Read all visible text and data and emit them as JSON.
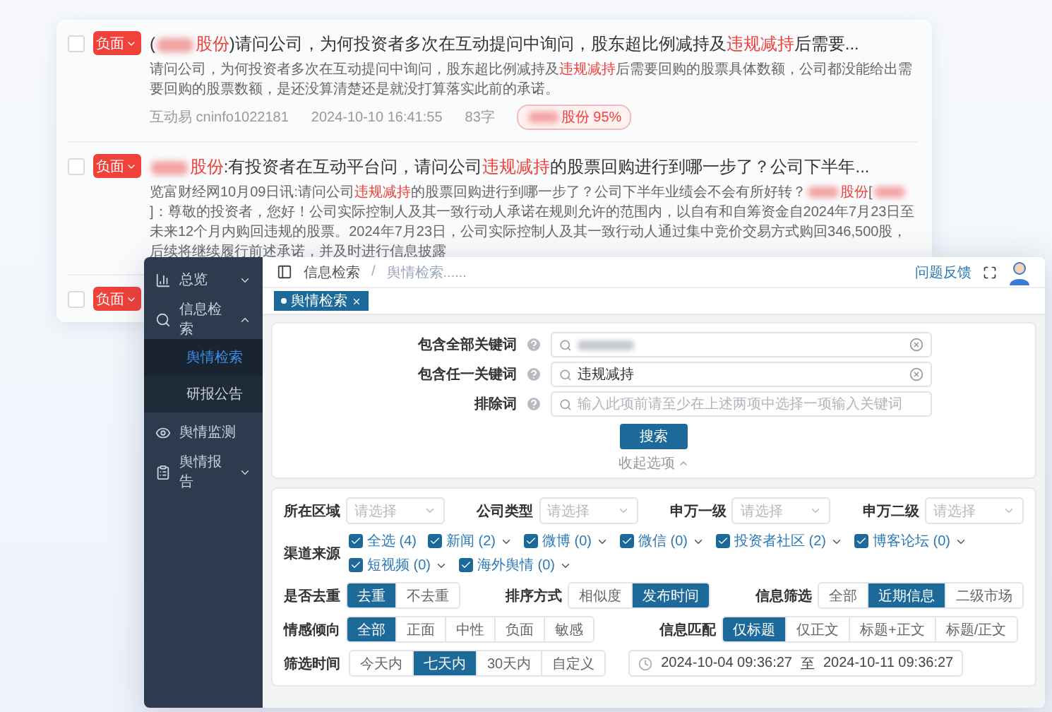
{
  "results": [
    {
      "sentiment": "负面",
      "checked": false,
      "title": [
        {
          "text": "("
        },
        {
          "kind": "blur"
        },
        {
          "text": "股份",
          "highlight": true
        },
        {
          "text": ")请问公司，为何投资者多次在互动提问中询问，股东超比例减持及"
        },
        {
          "text": "违规减持",
          "highlight": true
        },
        {
          "text": "后需要..."
        }
      ],
      "summary": [
        {
          "text": "请问公司，为何投资者多次在互动提问中询问，股东超比例减持及"
        },
        {
          "text": "违规减持",
          "highlight": true
        },
        {
          "text": "后需要回购的股票具体数额，公司都没能给出需要回购的股票数额，是还没算清楚还是就没打算落实此前的承诺。"
        }
      ],
      "meta": {
        "source": "互动易 cninfo1022181",
        "time": "2024-10-10 16:41:55",
        "length": "83字",
        "match": [
          {
            "kind": "blur"
          },
          {
            "text": "股份 95%"
          }
        ]
      }
    },
    {
      "sentiment": "负面",
      "checked": false,
      "title": [
        {
          "kind": "blur"
        },
        {
          "text": "股份",
          "highlight": true
        },
        {
          "text": ":有投资者在互动平台问，请问公司"
        },
        {
          "text": "违规减持",
          "highlight": true
        },
        {
          "text": "的股票回购进行到哪一步了？公司下半年..."
        }
      ],
      "summary": [
        {
          "text": "览富财经网10月09日讯:请问公司"
        },
        {
          "text": "违规减持",
          "highlight": true
        },
        {
          "text": "的股票回购进行到哪一步了？公司下半年业绩会不会有所好转？"
        },
        {
          "kind": "blur"
        },
        {
          "text": "股份",
          "highlight": true
        },
        {
          "text": "["
        },
        {
          "kind": "blur"
        },
        {
          "text": "]：尊敬的投资者，您好！公司实际控制人及其一致行动人承诺在规则允许的范围内，以自有和自筹资金自2024年7月23日至未来12个月内购回违规的股票。2024年7月23日，公司实际控制人及其一致行动人通过集中竞价交易方式购回346,500股，后续将继续履行前述承诺，并及时进行信息披露"
        }
      ]
    },
    {
      "sentiment": "负面",
      "checked": false
    }
  ],
  "app": {
    "sidebar": [
      {
        "label": "总览",
        "selected": false,
        "expanded": false
      },
      {
        "label": "信息检索",
        "selected": false,
        "expanded": true,
        "children": [
          {
            "label": "舆情检索",
            "selected": true
          },
          {
            "label": "研报公告",
            "selected": false
          }
        ]
      },
      {
        "label": "舆情监测",
        "selected": false
      },
      {
        "label": "舆情报告",
        "selected": false,
        "expanded": false
      }
    ],
    "breadcrumb": {
      "separator": "/",
      "items": [
        "信息检索",
        "舆情检索......"
      ]
    },
    "feedback": "问题反馈",
    "open_tabs": [
      {
        "label": "舆情检索",
        "selected": true
      }
    ],
    "keywords": [
      {
        "label": "包含全部关键词",
        "value_hidden": true
      },
      {
        "label": "包含任一关键词",
        "value": "违规减持"
      },
      {
        "label": "排除词",
        "placeholder": "输入此项前请至少在上述两项中选择一项输入关键词"
      }
    ],
    "search_button": "搜索",
    "collapse_link": "收起选项",
    "selects": [
      {
        "label": "所在区域",
        "placeholder": "请选择"
      },
      {
        "label": "公司类型",
        "placeholder": "请选择"
      },
      {
        "label": "申万一级",
        "placeholder": "请选择"
      },
      {
        "label": "申万二级",
        "placeholder": "请选择"
      }
    ],
    "channels": {
      "label": "渠道来源",
      "items": [
        {
          "label": "全选 (4)",
          "checked": true,
          "kind": "all"
        },
        {
          "label": "新闻 (2)",
          "checked": true,
          "kind": "menu"
        },
        {
          "label": "微博 (0)",
          "checked": true,
          "kind": "menu"
        },
        {
          "label": "微信 (0)",
          "checked": true,
          "kind": "menu"
        },
        {
          "label": "投资者社区 (2)",
          "checked": true,
          "kind": "menu"
        },
        {
          "label": "博客论坛 (0)",
          "checked": true,
          "kind": "menu"
        },
        {
          "label": "短视频 (0)",
          "checked": true,
          "kind": "menu"
        },
        {
          "label": "海外舆情 (0)",
          "checked": true,
          "kind": "menu"
        }
      ]
    },
    "option_groups": [
      [
        {
          "label": "是否去重",
          "options": [
            {
              "label": "去重",
              "selected": true
            },
            {
              "label": "不去重",
              "selected": false
            }
          ]
        },
        {
          "label": "排序方式",
          "options": [
            {
              "label": "相似度",
              "selected": false
            },
            {
              "label": "发布时间",
              "selected": true
            }
          ]
        },
        {
          "label": "信息筛选",
          "options": [
            {
              "label": "全部",
              "selected": false
            },
            {
              "label": "近期信息",
              "selected": true
            },
            {
              "label": "二级市场",
              "selected": false
            }
          ]
        }
      ],
      [
        {
          "label": "情感倾向",
          "options": [
            {
              "label": "全部",
              "selected": true
            },
            {
              "label": "正面",
              "selected": false
            },
            {
              "label": "中性",
              "selected": false
            },
            {
              "label": "负面",
              "selected": false
            },
            {
              "label": "敏感",
              "selected": false
            }
          ]
        },
        {
          "label": "信息匹配",
          "options": [
            {
              "label": "仅标题",
              "selected": true
            },
            {
              "label": "仅正文",
              "selected": false
            },
            {
              "label": "标题+正文",
              "selected": false
            },
            {
              "label": "标题/正文",
              "selected": false
            }
          ]
        }
      ]
    ],
    "time": {
      "label": "筛选时间",
      "options": [
        {
          "label": "今天内",
          "selected": false
        },
        {
          "label": "七天内",
          "selected": true
        },
        {
          "label": "30天内",
          "selected": false
        },
        {
          "label": "自定义",
          "selected": false
        }
      ],
      "start": "2024-10-04 09:36:27",
      "separator": "至",
      "end": "2024-10-11 09:36:27"
    }
  }
}
